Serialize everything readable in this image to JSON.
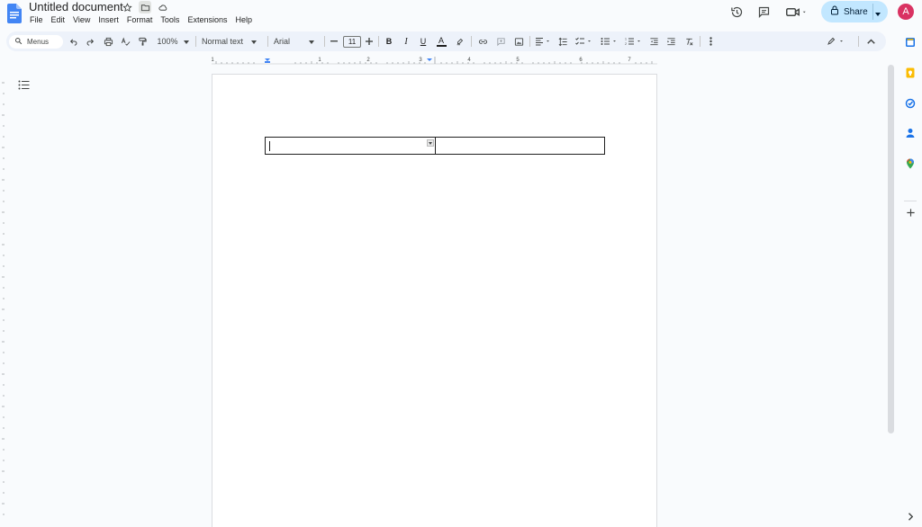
{
  "document": {
    "title": "Untitled document"
  },
  "menubar": {
    "items": [
      "File",
      "Edit",
      "View",
      "Insert",
      "Format",
      "Tools",
      "Extensions",
      "Help"
    ]
  },
  "header": {
    "share_label": "Share",
    "avatar_initial": "A",
    "avatar_color": "#d93262",
    "share_color": "#c2e7ff"
  },
  "toolbar": {
    "menus_label": "Menus",
    "zoom": "100%",
    "style": "Normal text",
    "font": "Arial",
    "font_size": "11",
    "bold": "B",
    "italic": "I",
    "underline": "U",
    "text_color": "A"
  },
  "ruler": {
    "labels": [
      "1",
      "1",
      "2",
      "3",
      "4",
      "5",
      "6",
      "7"
    ]
  },
  "icons": [
    "doc-icon",
    "star-icon",
    "folder-icon",
    "cloud-icon",
    "history-icon",
    "comment-icon",
    "meet-icon",
    "lock-icon",
    "search-icon",
    "undo-icon",
    "redo-icon",
    "print-icon",
    "spellcheck-icon",
    "paint-format-icon",
    "link-icon",
    "add-comment-icon",
    "image-icon",
    "align-icon",
    "line-spacing-icon",
    "checklist-icon",
    "bullet-list-icon",
    "numbered-list-icon",
    "outdent-icon",
    "indent-icon",
    "clear-format-icon",
    "more-icon",
    "edit-mode-icon",
    "collapse-icon",
    "outline-icon",
    "calendar-icon",
    "keep-icon",
    "tasks-icon",
    "contacts-icon",
    "maps-icon",
    "add-icon",
    "chevron-right-icon"
  ]
}
